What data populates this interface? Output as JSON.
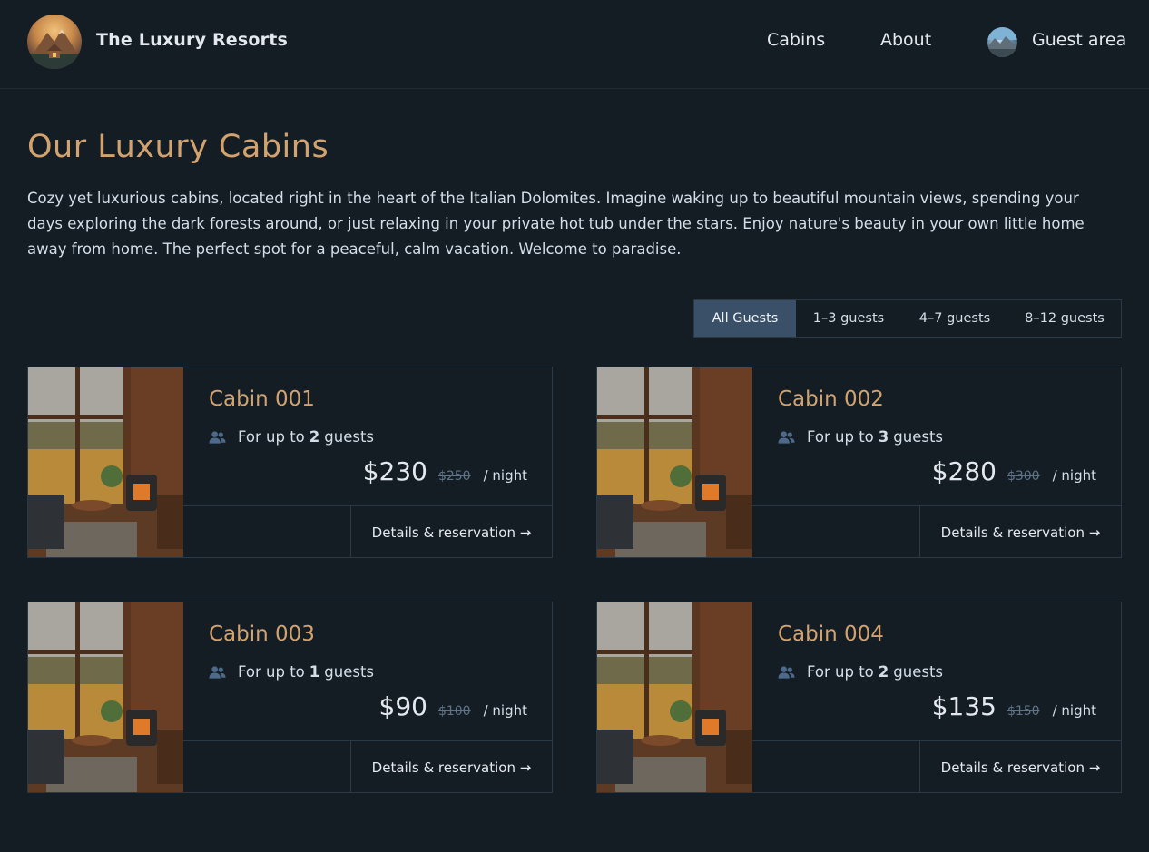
{
  "header": {
    "brand": "The Luxury Resorts",
    "nav": {
      "cabins": "Cabins",
      "about": "About",
      "guest_area": "Guest area"
    }
  },
  "intro": {
    "title": "Our Luxury Cabins",
    "description": "Cozy yet luxurious cabins, located right in the heart of the Italian Dolomites. Imagine waking up to beautiful mountain views, spending your days exploring the dark forests around, or just relaxing in your private hot tub under the stars. Enjoy nature's beauty in your own little home away from home. The perfect spot for a peaceful, calm vacation. Welcome to paradise."
  },
  "filter": {
    "options": [
      "All Guests",
      "1–3 guests",
      "4–7 guests",
      "8–12 guests"
    ],
    "selected": "All Guests"
  },
  "cabins": [
    {
      "name": "Cabin 001",
      "capacity_prefix": "For up to",
      "capacity": "2",
      "capacity_suffix": "guests",
      "price": "$230",
      "old_price": "$250",
      "per_night": "/ night",
      "details": "Details & reservation →"
    },
    {
      "name": "Cabin 002",
      "capacity_prefix": "For up to",
      "capacity": "3",
      "capacity_suffix": "guests",
      "price": "$280",
      "old_price": "$300",
      "per_night": "/ night",
      "details": "Details & reservation →"
    },
    {
      "name": "Cabin 003",
      "capacity_prefix": "For up to",
      "capacity": "1",
      "capacity_suffix": "guests",
      "price": "$90",
      "old_price": "$100",
      "per_night": "/ night",
      "details": "Details & reservation →"
    },
    {
      "name": "Cabin 004",
      "capacity_prefix": "For up to",
      "capacity": "2",
      "capacity_suffix": "guests",
      "price": "$135",
      "old_price": "$150",
      "per_night": "/ night",
      "details": "Details & reservation →"
    }
  ],
  "colors": {
    "background": "#141c24",
    "accent": "#d2a26f",
    "active_filter": "#3a5068",
    "border": "#2b3947"
  },
  "icons": {
    "capacity": "users-icon",
    "logo": "mountain-cabin-logo"
  }
}
